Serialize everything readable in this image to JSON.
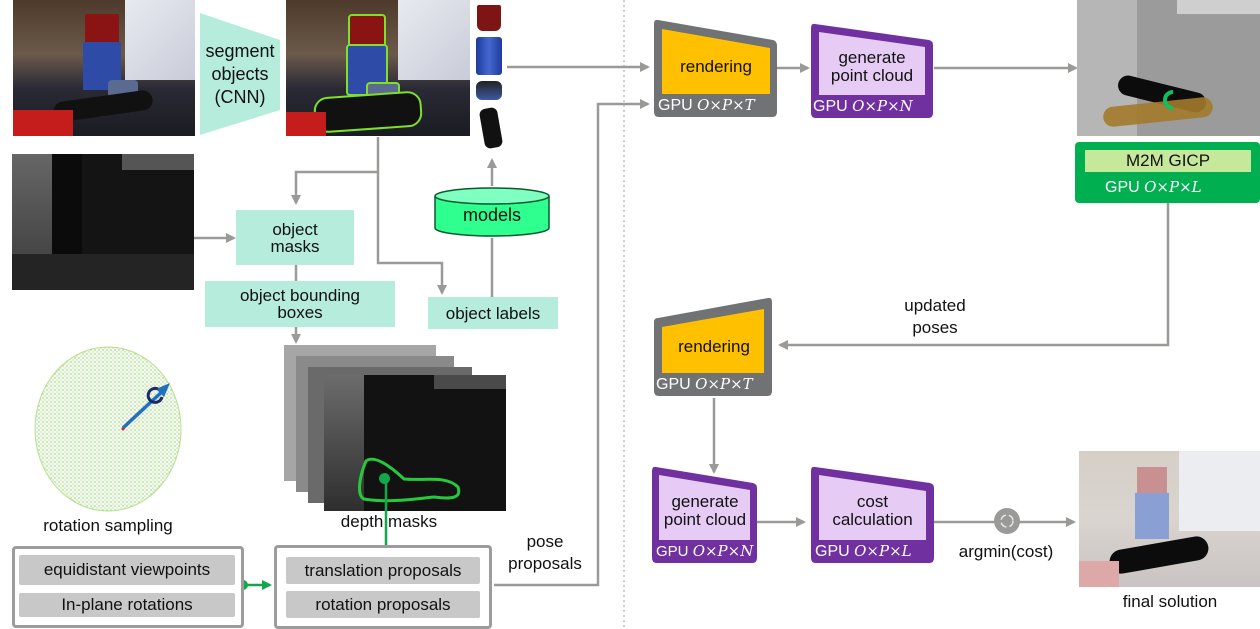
{
  "left_panel": {
    "segment_step": {
      "line1": "segment",
      "line2": "objects",
      "line3": "(CNN)"
    },
    "models_label": "models",
    "object_masks": {
      "line1": "object",
      "line2": "masks"
    },
    "object_bounding_boxes": {
      "line1": "object bounding",
      "line2": "boxes"
    },
    "object_labels": "object labels",
    "rotation_sampling": "rotation sampling",
    "depth_masks": "depth masks",
    "rotation_inputs": [
      "equidistant viewpoints",
      "In-plane rotations"
    ],
    "proposals": [
      "translation proposals",
      "rotation proposals"
    ],
    "pose_proposals": {
      "line1": "pose",
      "line2": "proposals"
    }
  },
  "right_panel": {
    "rendering_1": {
      "label": "rendering",
      "gpu": "GPU",
      "complexity": "O×P×T"
    },
    "point_cloud_1": {
      "line1": "generate",
      "line2": "point cloud",
      "gpu": "GPU",
      "complexity": "O×P×N"
    },
    "m2m_gicp": {
      "label": "M2M GICP",
      "gpu": "GPU",
      "complexity": "O×P×L"
    },
    "updated_poses": {
      "line1": "updated",
      "line2": "poses"
    },
    "rendering_2": {
      "label": "rendering",
      "gpu": "GPU",
      "complexity": "O×P×T"
    },
    "point_cloud_2": {
      "line1": "generate",
      "line2": "point cloud",
      "gpu": "GPU",
      "complexity": "O×P×N"
    },
    "cost_calc": {
      "line1": "cost",
      "line2": "calculation",
      "gpu": "GPU",
      "complexity": "O×P×L"
    },
    "argmin": "argmin(cost)",
    "final_solution": "final solution"
  },
  "colors": {
    "mint": "#b6ecdc",
    "models_green": "#2fff8f",
    "rendering_orange": "#ffc000",
    "render_frame_gray": "#707274",
    "purple_frame": "#7030a0",
    "purple_fill": "#e6cbf5",
    "gicp_green": "#00b050",
    "gicp_label_bg": "#c5e89a",
    "arrow_gray": "#9a9a98",
    "arrow_green": "#12a84a"
  }
}
